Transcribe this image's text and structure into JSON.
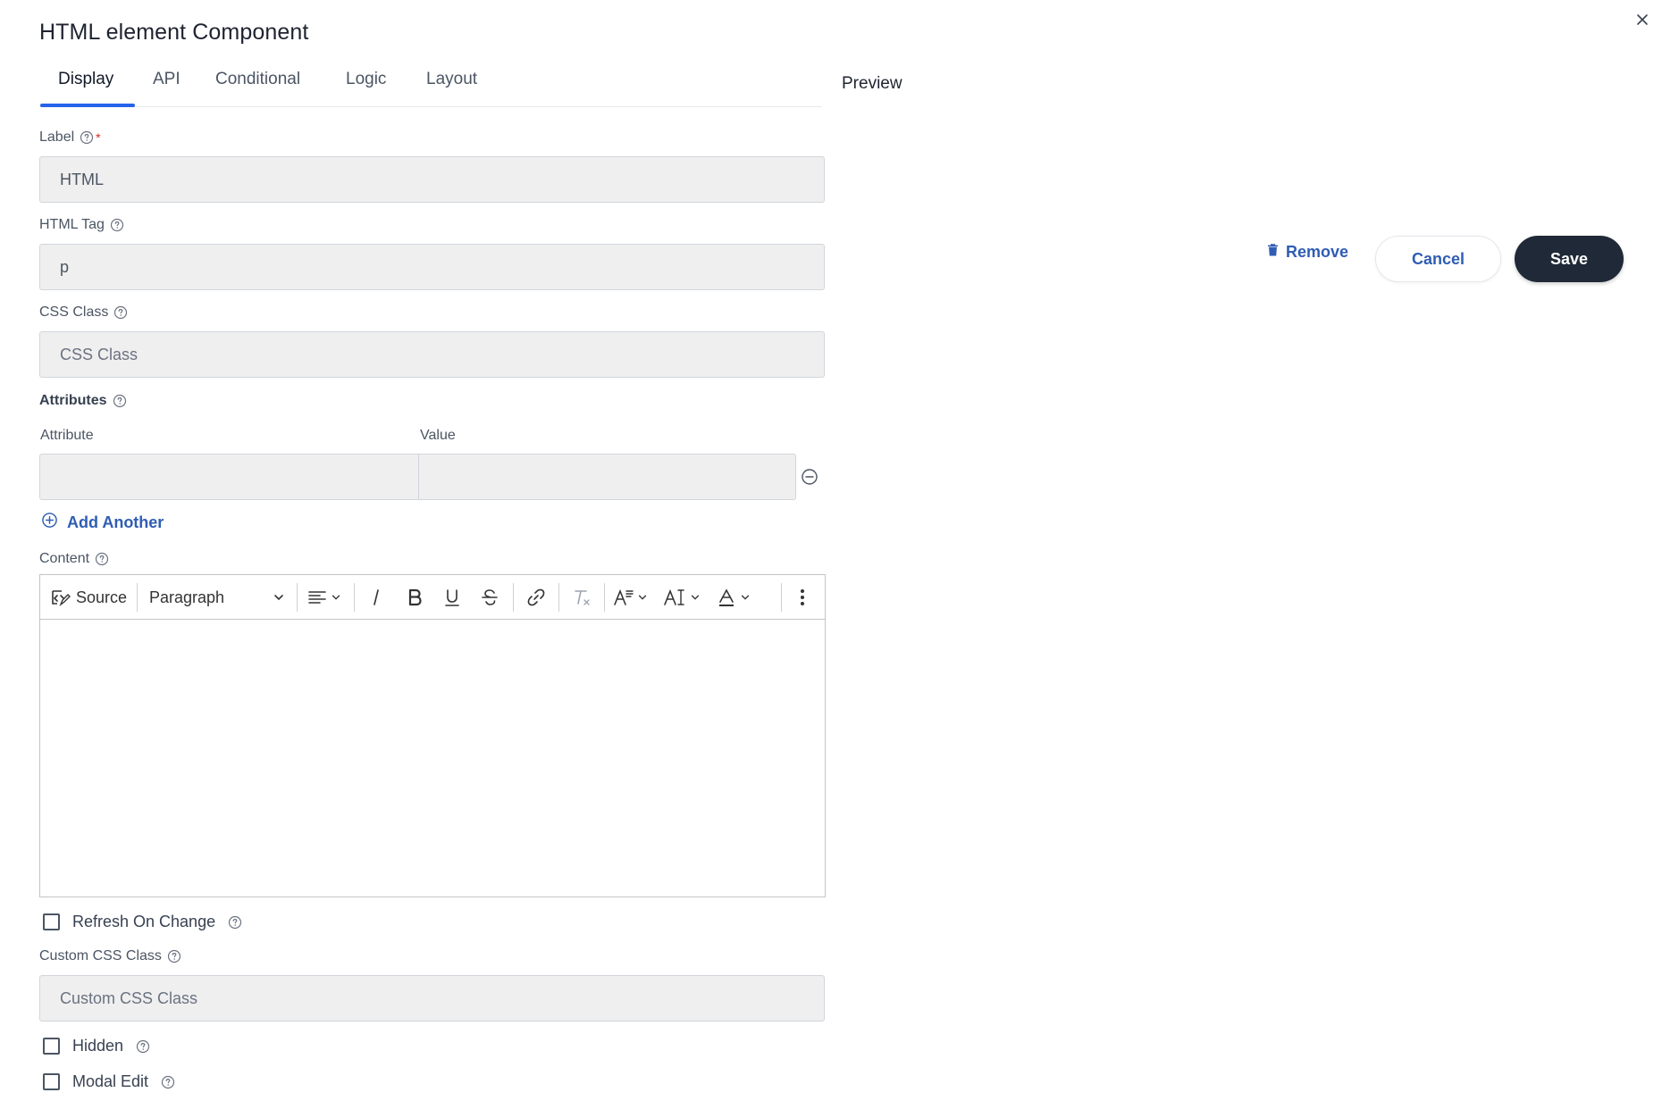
{
  "dialog": {
    "title": "HTML element Component",
    "preview_label": "Preview"
  },
  "tabs": [
    {
      "label": "Display",
      "active": true
    },
    {
      "label": "API",
      "active": false
    },
    {
      "label": "Conditional",
      "active": false
    },
    {
      "label": "Logic",
      "active": false
    },
    {
      "label": "Layout",
      "active": false
    }
  ],
  "fields": {
    "label": {
      "label": "Label",
      "required_mark": "*",
      "value": "HTML"
    },
    "html_tag": {
      "label": "HTML Tag",
      "value": "p"
    },
    "css_class": {
      "label": "CSS Class",
      "placeholder": "CSS Class"
    },
    "attributes": {
      "label": "Attributes",
      "col_attribute": "Attribute",
      "col_value": "Value",
      "rows": [
        {
          "attribute": "",
          "value": ""
        }
      ],
      "add_another": "Add Another"
    },
    "content": {
      "label": "Content",
      "toolbar": {
        "source": "Source",
        "block_format": "Paragraph"
      }
    },
    "refresh_on_change": {
      "label": "Refresh On Change",
      "checked": false
    },
    "custom_css_class": {
      "label": "Custom CSS Class",
      "placeholder": "Custom CSS Class"
    },
    "hidden": {
      "label": "Hidden",
      "checked": false
    },
    "modal_edit": {
      "label": "Modal Edit",
      "checked": false
    }
  },
  "actions": {
    "remove": "Remove",
    "cancel": "Cancel",
    "save": "Save"
  },
  "colors": {
    "accent": "#2563eb",
    "link": "#2f5db3",
    "save_bg": "#1f2937",
    "input_bg": "#efefef",
    "required": "#dc2626"
  },
  "icons": {
    "close": "close-icon",
    "help": "help-circle-icon",
    "remove_row": "minus-circle-icon",
    "add": "plus-circle-icon",
    "trash": "trash-icon"
  }
}
